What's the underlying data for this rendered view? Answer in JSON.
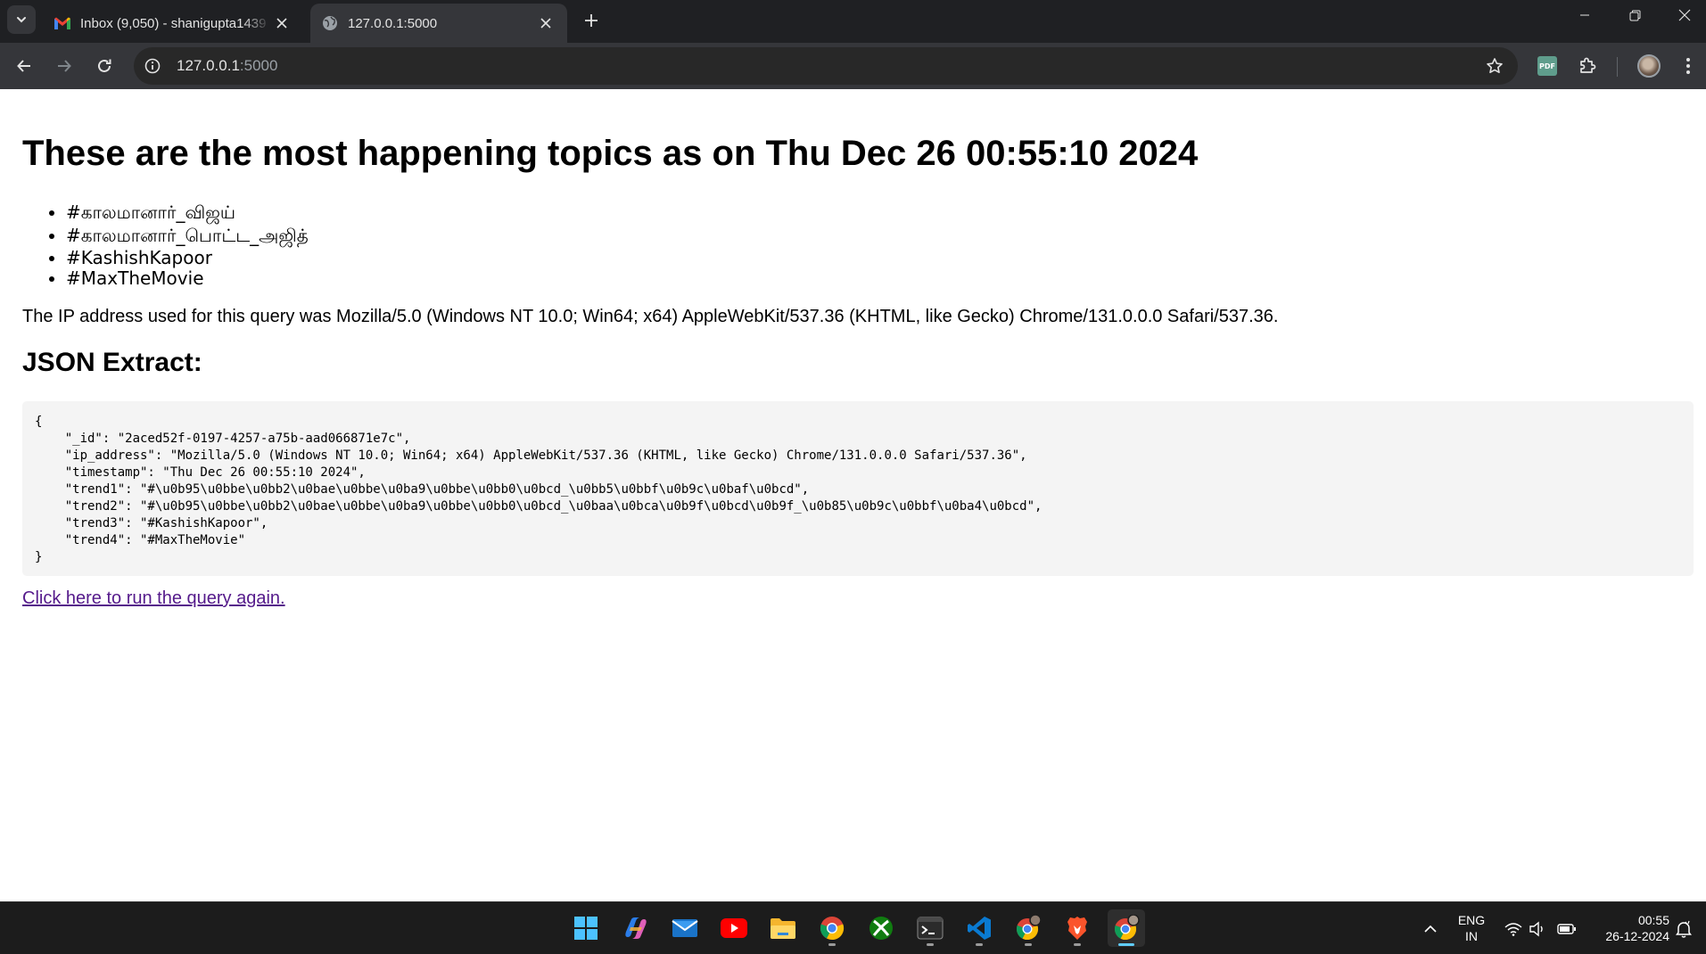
{
  "browser": {
    "tabs": [
      {
        "title": "Inbox (9,050) - shanigupta1439",
        "favicon": "gmail-icon",
        "active": false
      },
      {
        "title": "127.0.0.1:5000",
        "favicon": "globe-icon",
        "active": true
      }
    ],
    "address": {
      "host": "127.0.0.1",
      "port": ":5000"
    }
  },
  "page": {
    "heading": "These are the most happening topics as on Thu Dec 26 00:55:10 2024",
    "trends": [
      "#காலமானார்_விஜய்",
      "#காலமானார்_பொட்ட_அஜித்",
      "#KashishKapoor",
      "#MaxTheMovie"
    ],
    "ip_sentence": "The IP address used for this query was Mozilla/5.0 (Windows NT 10.0; Win64; x64) AppleWebKit/537.36 (KHTML, like Gecko) Chrome/131.0.0.0 Safari/537.36.",
    "json_heading": "JSON Extract:",
    "json_text": "{\n    \"_id\": \"2aced52f-0197-4257-a75b-aad066871e7c\",\n    \"ip_address\": \"Mozilla/5.0 (Windows NT 10.0; Win64; x64) AppleWebKit/537.36 (KHTML, like Gecko) Chrome/131.0.0.0 Safari/537.36\",\n    \"timestamp\": \"Thu Dec 26 00:55:10 2024\",\n    \"trend1\": \"#\\u0b95\\u0bbe\\u0bb2\\u0bae\\u0bbe\\u0ba9\\u0bbe\\u0bb0\\u0bcd_\\u0bb5\\u0bbf\\u0b9c\\u0baf\\u0bcd\",\n    \"trend2\": \"#\\u0b95\\u0bbe\\u0bb2\\u0bae\\u0bbe\\u0ba9\\u0bbe\\u0bb0\\u0bcd_\\u0baa\\u0bca\\u0b9f\\u0bcd\\u0b9f_\\u0b85\\u0b9c\\u0bbf\\u0ba4\\u0bcd\",\n    \"trend3\": \"#KashishKapoor\",\n    \"trend4\": \"#MaxTheMovie\"\n}",
    "rerun_link": "Click here to run the query again."
  },
  "taskbar": {
    "apps": [
      {
        "name": "windows-start-icon"
      },
      {
        "name": "copilot-icon"
      },
      {
        "name": "mail-icon"
      },
      {
        "name": "youtube-icon"
      },
      {
        "name": "file-explorer-icon"
      },
      {
        "name": "chrome-icon"
      },
      {
        "name": "xbox-icon"
      },
      {
        "name": "terminal-icon"
      },
      {
        "name": "vscode-icon"
      },
      {
        "name": "chrome-profile-icon"
      },
      {
        "name": "brave-icon"
      },
      {
        "name": "chrome-profile-active-icon"
      }
    ],
    "language": {
      "line1": "ENG",
      "line2": "IN"
    },
    "clock": {
      "time": "00:55",
      "date": "26-12-2024"
    }
  },
  "colors": {
    "tabstrip": "#1f2023",
    "toolbar": "#35363a",
    "link_visited": "#551a8b",
    "code_background": "#f4f4f4",
    "taskbar": "#1c1c1c"
  }
}
